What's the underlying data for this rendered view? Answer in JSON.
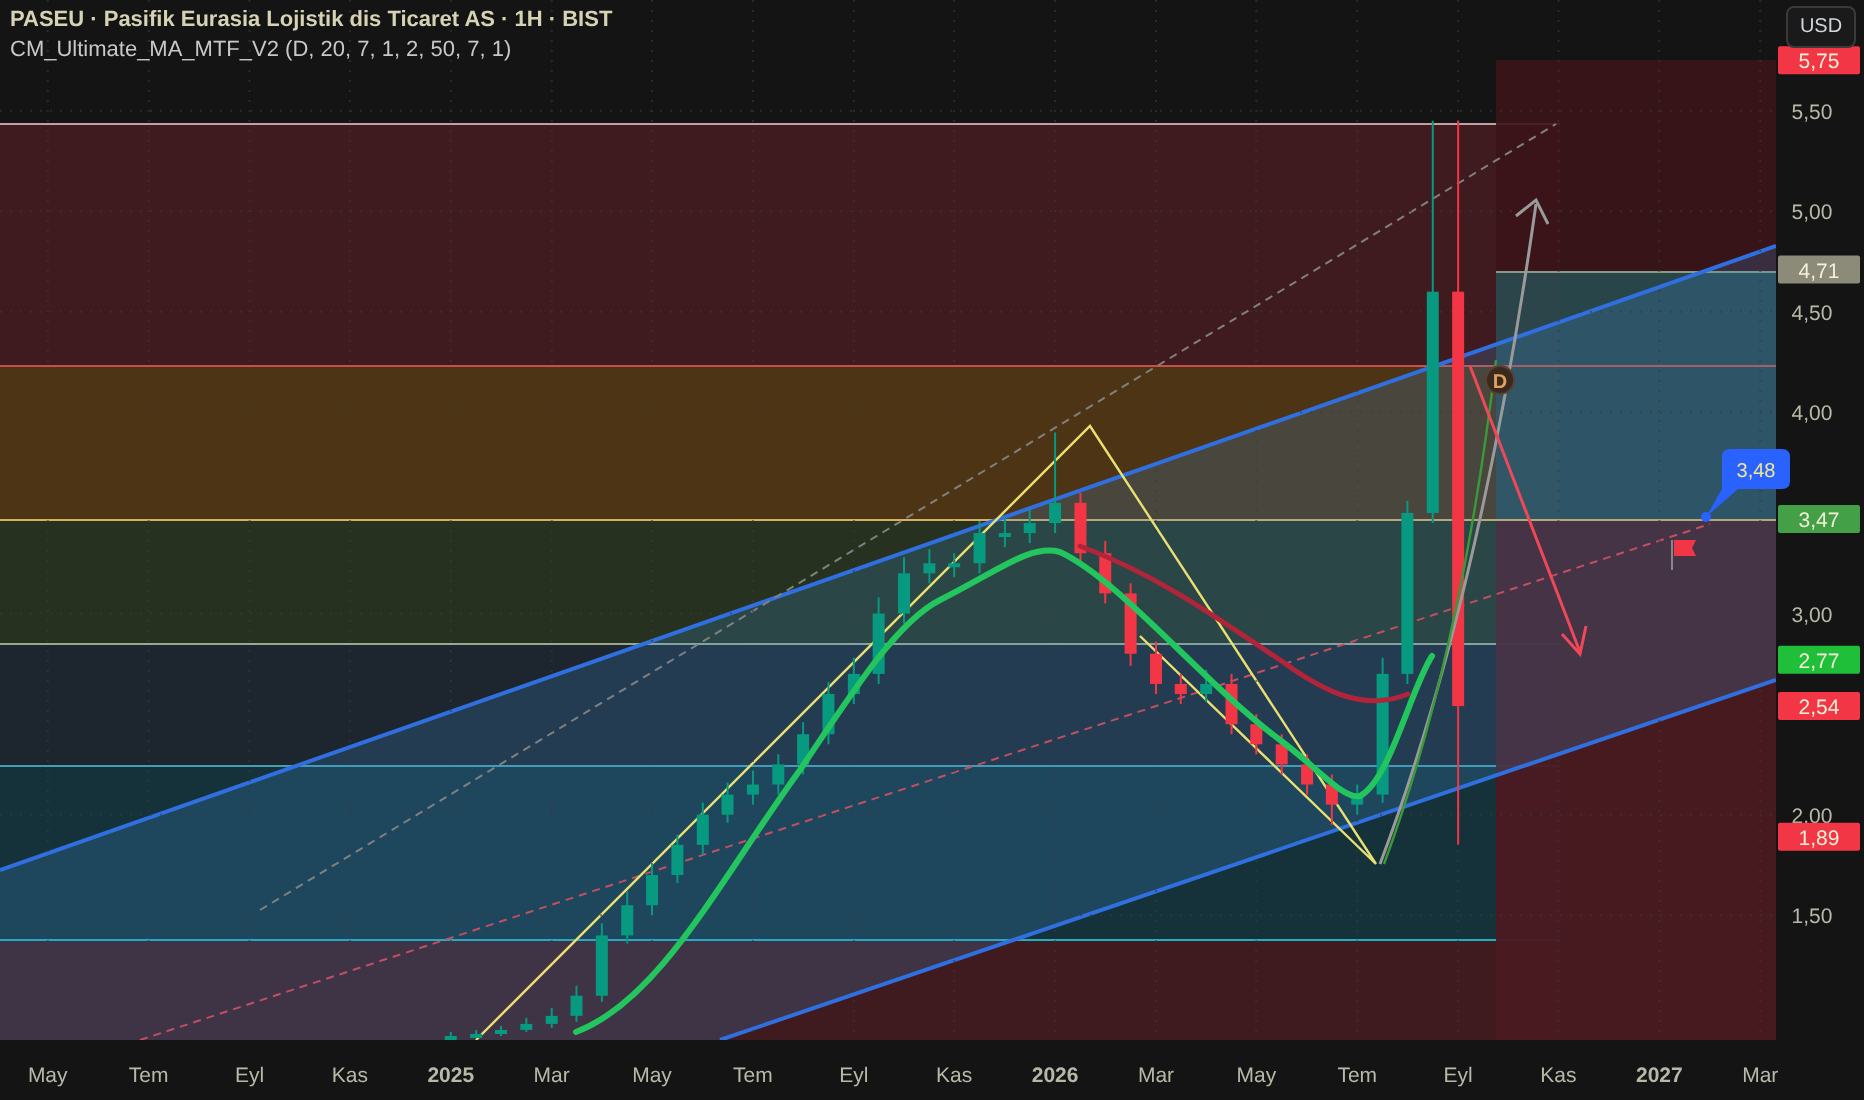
{
  "header": {
    "title": "PASEU · Pasifik Eurasia Lojistik dis Ticaret AS · 1H · BIST",
    "indicator": "CM_Ultimate_MA_MTF_V2 (D, 20, 7, 1, 2, 50, 7, 1)"
  },
  "currency_button": "USD",
  "chart": {
    "chart_data": {
      "type": "candlestick",
      "grid": true,
      "x": [
        2025.0,
        2025.042,
        2025.083,
        2025.125,
        2025.167,
        2025.208,
        2025.25,
        2025.292,
        2025.333,
        2025.375,
        2025.417,
        2025.458,
        2025.5,
        2025.542,
        2025.583,
        2025.625,
        2025.667,
        2025.708,
        2025.75,
        2025.792,
        2025.833,
        2025.875,
        2025.917,
        2025.958,
        2026.0,
        2026.042,
        2026.083,
        2026.125,
        2026.167,
        2026.208,
        2026.25,
        2026.292,
        2026.333,
        2026.375,
        2026.417,
        2026.458,
        2026.5,
        2026.542,
        2026.583,
        2026.625,
        2026.667
      ],
      "ohlc": [
        [
          0.89,
          0.92,
          0.88,
          0.9
        ],
        [
          0.9,
          0.93,
          0.89,
          0.91
        ],
        [
          0.91,
          0.95,
          0.9,
          0.93
        ],
        [
          0.93,
          0.99,
          0.92,
          0.96
        ],
        [
          0.96,
          1.04,
          0.94,
          1.0
        ],
        [
          1.0,
          1.15,
          0.97,
          1.1
        ],
        [
          1.1,
          1.46,
          1.07,
          1.4
        ],
        [
          1.4,
          1.62,
          1.36,
          1.55
        ],
        [
          1.55,
          1.76,
          1.5,
          1.7
        ],
        [
          1.7,
          1.9,
          1.66,
          1.85
        ],
        [
          1.85,
          2.06,
          1.8,
          2.0
        ],
        [
          2.0,
          2.16,
          1.96,
          2.1
        ],
        [
          2.1,
          2.22,
          2.05,
          2.15
        ],
        [
          2.15,
          2.3,
          2.1,
          2.25
        ],
        [
          2.25,
          2.46,
          2.2,
          2.4
        ],
        [
          2.4,
          2.66,
          2.35,
          2.6
        ],
        [
          2.6,
          2.78,
          2.55,
          2.7
        ],
        [
          2.7,
          3.08,
          2.65,
          3.0
        ],
        [
          3.0,
          3.28,
          2.95,
          3.2
        ],
        [
          3.2,
          3.32,
          3.15,
          3.25
        ],
        [
          3.25,
          3.3,
          3.18,
          3.25
        ],
        [
          3.25,
          3.46,
          3.2,
          3.4
        ],
        [
          3.4,
          3.48,
          3.33,
          3.4
        ],
        [
          3.4,
          3.52,
          3.35,
          3.45
        ],
        [
          3.45,
          3.9,
          3.4,
          3.55
        ],
        [
          3.55,
          3.6,
          3.25,
          3.3
        ],
        [
          3.3,
          3.36,
          3.05,
          3.1
        ],
        [
          3.1,
          3.15,
          2.74,
          2.8
        ],
        [
          2.8,
          2.86,
          2.6,
          2.65
        ],
        [
          2.65,
          2.7,
          2.55,
          2.6
        ],
        [
          2.6,
          2.72,
          2.56,
          2.65
        ],
        [
          2.65,
          2.7,
          2.4,
          2.45
        ],
        [
          2.45,
          2.5,
          2.3,
          2.35
        ],
        [
          2.35,
          2.4,
          2.2,
          2.25
        ],
        [
          2.25,
          2.3,
          2.1,
          2.15
        ],
        [
          2.15,
          2.2,
          1.95,
          2.05
        ],
        [
          2.05,
          2.15,
          2.0,
          2.1
        ],
        [
          2.1,
          2.78,
          2.06,
          2.7
        ],
        [
          2.7,
          3.56,
          2.65,
          3.5
        ],
        [
          3.5,
          5.45,
          3.45,
          4.6
        ],
        [
          4.6,
          5.45,
          1.85,
          2.54
        ]
      ],
      "xlim": [
        2024.254,
        2027.193
      ],
      "ylim": [
        0.88,
        6.05
      ],
      "xticks": [
        {
          "value": 2024.333,
          "label": "May"
        },
        {
          "value": 2024.5,
          "label": "Tem"
        },
        {
          "value": 2024.667,
          "label": "Eyl"
        },
        {
          "value": 2024.833,
          "label": "Kas"
        },
        {
          "value": 2025,
          "label": "2025"
        },
        {
          "value": 2025.167,
          "label": "Mar"
        },
        {
          "value": 2025.333,
          "label": "May"
        },
        {
          "value": 2025.5,
          "label": "Tem"
        },
        {
          "value": 2025.667,
          "label": "Eyl"
        },
        {
          "value": 2025.833,
          "label": "Kas"
        },
        {
          "value": 2026,
          "label": "2026"
        },
        {
          "value": 2026.167,
          "label": "Mar"
        },
        {
          "value": 2026.333,
          "label": "May"
        },
        {
          "value": 2026.5,
          "label": "Tem"
        },
        {
          "value": 2026.667,
          "label": "Eyl"
        },
        {
          "value": 2026.833,
          "label": "Kas"
        },
        {
          "value": 2027,
          "label": "2027"
        },
        {
          "value": 2027.167,
          "label": "Mar"
        }
      ],
      "yticks": [
        {
          "value": 1.5,
          "label": "1,50"
        },
        {
          "value": 2,
          "label": "2,00"
        },
        {
          "value": 3,
          "label": "3,00"
        },
        {
          "value": 4,
          "label": "4,00"
        },
        {
          "value": 4.5,
          "label": "4,50"
        },
        {
          "value": 5,
          "label": "5,00"
        },
        {
          "value": 5.5,
          "label": "5,50"
        }
      ]
    }
  },
  "price_labels": [
    {
      "text": "5,75",
      "color": "#f23645"
    },
    {
      "text": "4,71",
      "color": "#8c8a78"
    },
    {
      "text": "3,47",
      "color": "#43a047"
    },
    {
      "text": "2,77",
      "color": "#1fbf3a"
    },
    {
      "text": "2,54",
      "color": "#f23645"
    },
    {
      "text": "1,89",
      "color": "#f23645"
    }
  ],
  "callout": "3,48",
  "marker": "D"
}
